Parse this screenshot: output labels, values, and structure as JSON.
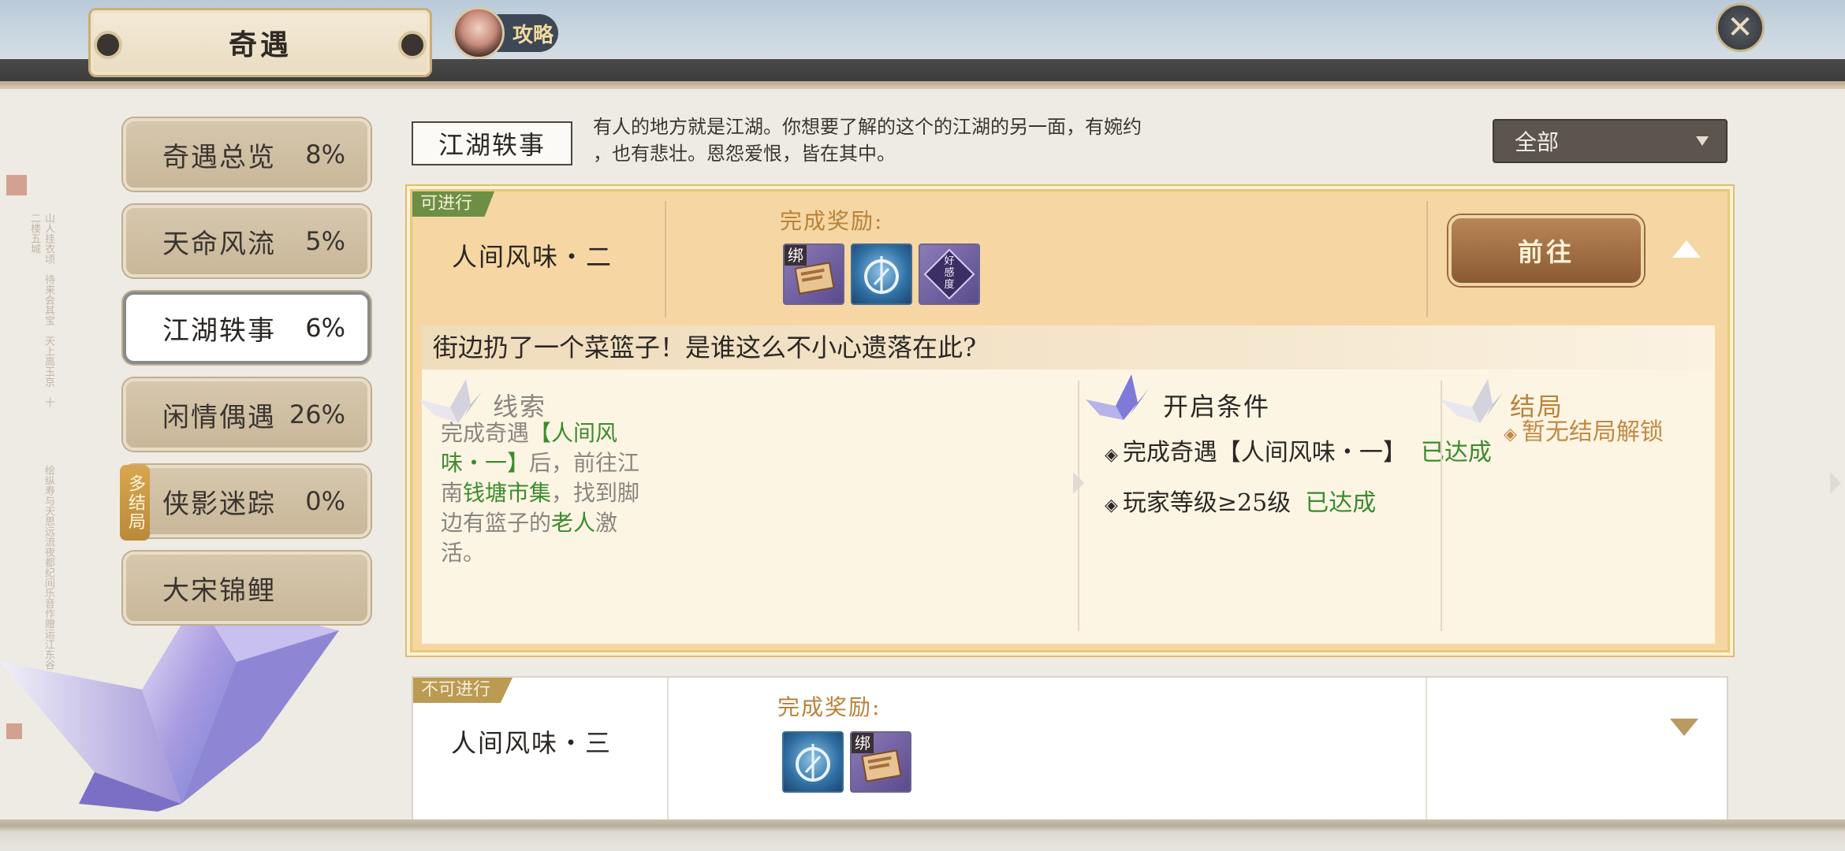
{
  "header": {
    "title": "奇遇",
    "guide_label": "攻略",
    "close_glyph": "✕"
  },
  "sidebar": {
    "items": [
      {
        "label": "奇遇总览",
        "percent": "8%"
      },
      {
        "label": "天命风流",
        "percent": "5%"
      },
      {
        "label": "江湖轶事",
        "percent": "6%",
        "active": true
      },
      {
        "label": "闲情偶遇",
        "percent": "26%"
      },
      {
        "label": "侠影迷踪",
        "percent": "0%",
        "badge": "多结局"
      },
      {
        "label": "大宋锦鲤",
        "percent": ""
      }
    ]
  },
  "category": {
    "name": "江湖轶事",
    "description_line1": "有人的地方就是江湖。你想要了解的这个的江湖的另一面，有婉约",
    "description_line2": "，也有悲壮。恩怨爱恨，皆在其中。"
  },
  "filter": {
    "selected": "全部"
  },
  "cards": [
    {
      "status": "可进行",
      "name": "人间风味・二",
      "reward_label": "完成奖励:",
      "go_label": "前往",
      "rewards": [
        {
          "icon": "book-item-icon",
          "bind_tag": "绑"
        },
        {
          "icon": "compass-item-icon"
        },
        {
          "icon": "favor-item-icon",
          "text": "好感度"
        }
      ],
      "detail": {
        "title": "街边扔了一个菜篮子！是谁这么不小心遗落在此?",
        "clue_head": "线索",
        "clue_parts": [
          "完成奇遇",
          "【人间风味・一】",
          "后，前往江南",
          "钱塘市集",
          "，找到脚边有篮子的",
          "老人",
          "激活。"
        ],
        "condition_head": "开启条件",
        "conditions": [
          {
            "text": "完成奇遇【人间风味・一】",
            "state": "已达成"
          },
          {
            "text": "玩家等级≥25级",
            "state": "已达成"
          }
        ],
        "ending_head": "结局",
        "ending_text": "暂无结局解锁"
      }
    },
    {
      "status": "不可进行",
      "name": "人间风味・三",
      "reward_label": "完成奖励:",
      "rewards": [
        {
          "icon": "compass-item-icon"
        },
        {
          "icon": "book-item-icon",
          "bind_tag": "绑"
        }
      ]
    }
  ],
  "colors": {
    "accent_gold": "#b9823a",
    "achieved_green": "#3c8b2e",
    "card_active_bg": "#f6d7a3",
    "status_available": "#6d8f45",
    "status_unavailable": "#bb9a52"
  }
}
